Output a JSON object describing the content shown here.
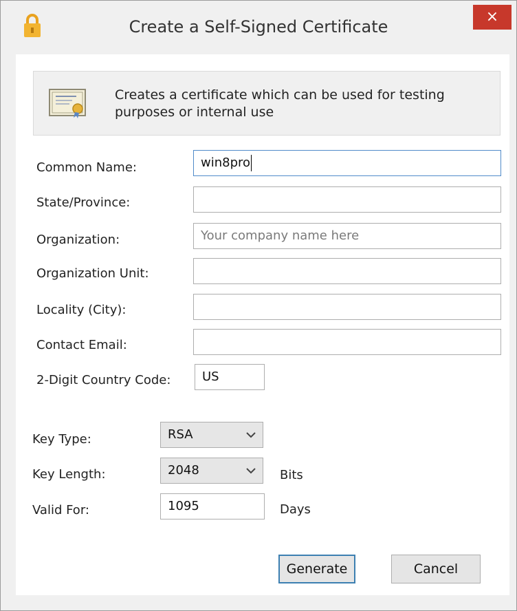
{
  "dialog": {
    "title": "Create a Self-Signed Certificate",
    "close_label": "×"
  },
  "banner": {
    "description": "Creates a certificate which can be used for testing purposes or internal use"
  },
  "fields": {
    "common_name": {
      "label": "Common Name:",
      "value": "win8pro"
    },
    "state": {
      "label": "State/Province:",
      "value": ""
    },
    "organization": {
      "label": "Organization:",
      "value": "",
      "placeholder": "Your company name here"
    },
    "org_unit": {
      "label": "Organization Unit:",
      "value": ""
    },
    "locality": {
      "label": "Locality (City):",
      "value": ""
    },
    "email": {
      "label": "Contact Email:",
      "value": ""
    },
    "country": {
      "label": "2-Digit Country Code:",
      "value": "US"
    }
  },
  "key": {
    "type_label": "Key Type:",
    "type_value": "RSA",
    "length_label": "Key Length:",
    "length_value": "2048",
    "length_unit": "Bits",
    "valid_label": "Valid For:",
    "valid_value": "1095",
    "valid_unit": "Days"
  },
  "buttons": {
    "generate": "Generate",
    "cancel": "Cancel"
  },
  "colors": {
    "close_button": "#c7382b",
    "focus_border": "#4f8ac9",
    "default_button_border": "#3c7fb1",
    "lock_gold": "#e9a21f"
  },
  "icons": {
    "title_icon": "lock-icon",
    "banner_icon": "certificate-icon",
    "dropdown_icon": "chevron-down-icon"
  }
}
